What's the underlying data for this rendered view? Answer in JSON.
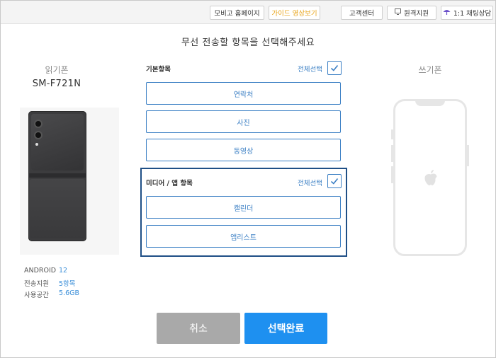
{
  "topbar": {
    "mobile_home": "모비고 홈페이지",
    "guide_video": "가이드 영상보기",
    "customer_center": "고객센터",
    "remote_support": "원격지원",
    "chat_consult": "1:1 채팅상담"
  },
  "title": "무선 전송할 항목을 선택해주세요",
  "source": {
    "label": "읽기폰",
    "model": "SM-F721N",
    "specs": [
      {
        "key": "ANDROID",
        "value": "12"
      },
      {
        "key": "전송지원",
        "value": "5항목"
      },
      {
        "key": "사용공간",
        "value": "5.6GB"
      }
    ]
  },
  "target": {
    "label": "쓰기폰"
  },
  "basic": {
    "label": "기본항목",
    "select_all": "전체선택",
    "items": [
      "연락처",
      "사진",
      "동영상"
    ]
  },
  "media": {
    "label": "미디어 / 앱 항목",
    "select_all": "전체선택",
    "items": [
      "캘린더",
      "앱리스트"
    ]
  },
  "actions": {
    "cancel": "취소",
    "done": "선택완료"
  },
  "colors": {
    "accent": "#3b7fc4",
    "primary_button": "#1e90f0",
    "media_border": "#1f4f86",
    "guide_text": "#e8a317"
  }
}
